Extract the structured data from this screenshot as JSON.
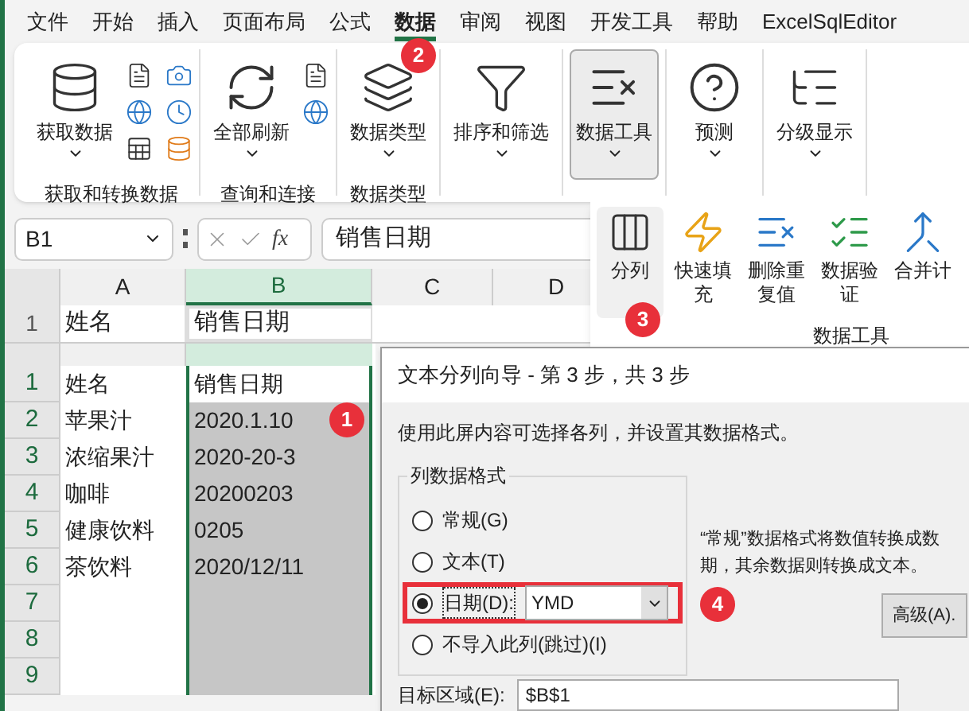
{
  "ribbon_tabs": [
    {
      "label": "文件",
      "selected": false
    },
    {
      "label": "开始",
      "selected": false
    },
    {
      "label": "插入",
      "selected": false
    },
    {
      "label": "页面布局",
      "selected": false
    },
    {
      "label": "公式",
      "selected": false
    },
    {
      "label": "数据",
      "selected": true,
      "badge": "2"
    },
    {
      "label": "审阅",
      "selected": false
    },
    {
      "label": "视图",
      "selected": false
    },
    {
      "label": "开发工具",
      "selected": false
    },
    {
      "label": "帮助",
      "selected": false
    },
    {
      "label": "ExcelSqlEditor",
      "selected": false
    }
  ],
  "ribbon_groups": [
    {
      "label": "获取和转换数据",
      "button": {
        "label": "获取数据",
        "kind": "database",
        "pressed": false
      }
    },
    {
      "label": "查询和连接",
      "button": {
        "label": "全部刷新",
        "kind": "refresh",
        "pressed": false
      }
    },
    {
      "label": "数据类型",
      "button": {
        "label": "数据类型",
        "kind": "layers",
        "pressed": false
      }
    },
    {
      "button": {
        "label": "排序和筛选",
        "kind": "filter",
        "pressed": false
      }
    },
    {
      "button": {
        "label": "数据工具",
        "kind": "table-x",
        "pressed": true
      }
    },
    {
      "button": {
        "label": "预测",
        "kind": "help",
        "pressed": false
      }
    },
    {
      "button": {
        "label": "分级显示",
        "kind": "outline",
        "pressed": false
      }
    }
  ],
  "name_box": "B1",
  "function_label": "fx",
  "formula": "销售日期",
  "sheet_top": {
    "columns": [
      {
        "label": "A",
        "selected": false
      },
      {
        "label": "B",
        "selected": true
      },
      {
        "label": "C",
        "selected": false
      },
      {
        "label": "D",
        "selected": false
      }
    ],
    "rows": [
      {
        "number": "1",
        "cells": [
          "姓名",
          "销售日期"
        ]
      }
    ]
  },
  "sheet": {
    "badge": "1",
    "rows": [
      {
        "number": "1",
        "cells": [
          "姓名",
          "销售日期"
        ]
      },
      {
        "number": "2",
        "cells": [
          "苹果汁",
          "2020.1.10"
        ]
      },
      {
        "number": "3",
        "cells": [
          "浓缩果汁",
          "2020-20-3"
        ]
      },
      {
        "number": "4",
        "cells": [
          "咖啡",
          "20200203"
        ]
      },
      {
        "number": "5",
        "cells": [
          "健康饮料",
          "0205"
        ]
      },
      {
        "number": "6",
        "cells": [
          "茶饮料",
          "2020/12/11"
        ]
      },
      {
        "number": "7",
        "cells": [
          "",
          ""
        ]
      },
      {
        "number": "8",
        "cells": [
          "",
          ""
        ]
      },
      {
        "number": "9",
        "cells": [
          "",
          ""
        ]
      }
    ]
  },
  "data_tools_panel": {
    "badge": "3",
    "group_label": "数据工具",
    "items": [
      {
        "label": "分列",
        "kind": "split",
        "selected": true
      },
      {
        "label": "快速填充",
        "kind": "flash",
        "selected": false
      },
      {
        "label": "删除重复值",
        "kind": "remove",
        "selected": false
      },
      {
        "label": "数据验证",
        "kind": "validate",
        "selected": false
      },
      {
        "label": "合并计",
        "kind": "merge",
        "selected": false
      }
    ]
  },
  "dialog": {
    "title": "文本分列向导 - 第 3 步，共 3 步",
    "description": "使用此屏内容可选择各列，并设置其数据格式。",
    "group_label": "列数据格式",
    "options": [
      {
        "label": "常规(G)",
        "selected": false,
        "highlighted": false
      },
      {
        "label": "文本(T)",
        "selected": false,
        "highlighted": false
      },
      {
        "label": "日期(D):",
        "selected": true,
        "highlighted": true,
        "format": "YMD",
        "badge": "4"
      },
      {
        "label": "不导入此列(跳过)(I)",
        "selected": false,
        "highlighted": false
      }
    ],
    "hint_lines": [
      "“常规”数据格式将数值转换成数",
      "期，其余数据则转换成文本。"
    ],
    "advanced_button": "高级(A).",
    "target_label": "目标区域(E):",
    "target_value": "$B$1"
  }
}
